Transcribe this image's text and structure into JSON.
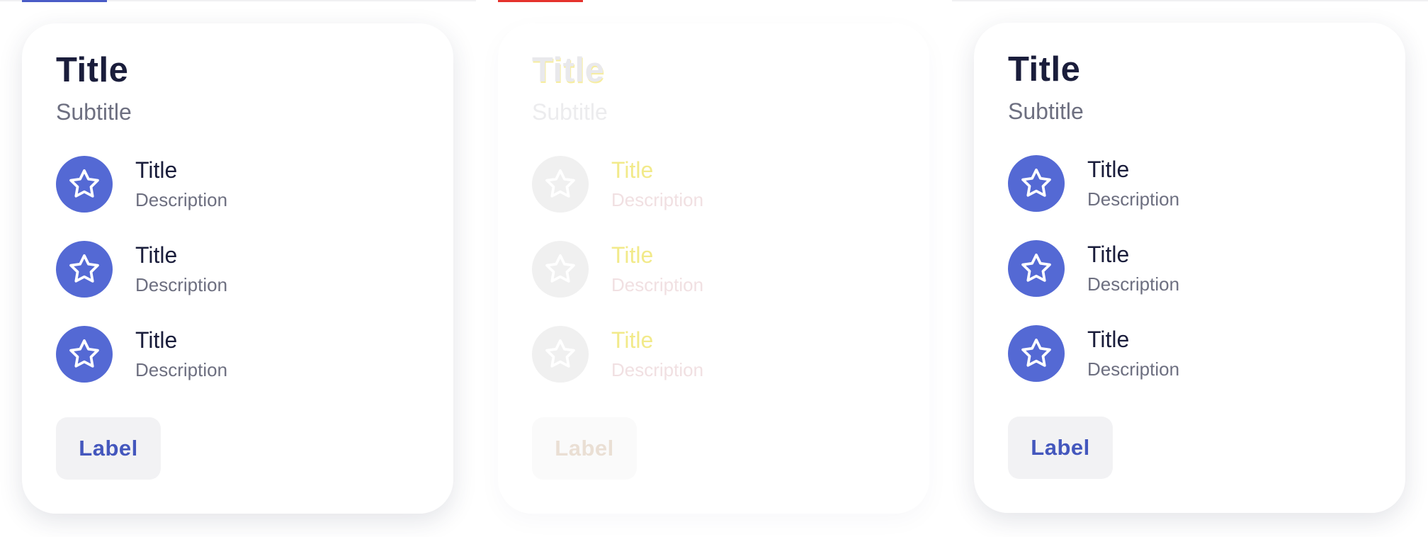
{
  "colors": {
    "accent": "#5469d4",
    "title_text": "#1a1d3b",
    "secondary_text": "#6d6f80",
    "button_bg": "#f2f2f4",
    "button_text": "#4457bd"
  },
  "cards": [
    {
      "title": "Title",
      "subtitle": "Subtitle",
      "items": [
        {
          "icon": "star-icon",
          "title": "Title",
          "description": "Description"
        },
        {
          "icon": "star-icon",
          "title": "Title",
          "description": "Description"
        },
        {
          "icon": "star-icon",
          "title": "Title",
          "description": "Description"
        }
      ],
      "button_label": "Label"
    },
    {
      "title": "Title",
      "subtitle": "Subtitle",
      "items": [
        {
          "icon": "star-icon",
          "title": "Title",
          "description": "Description"
        },
        {
          "icon": "star-icon",
          "title": "Title",
          "description": "Description"
        },
        {
          "icon": "star-icon",
          "title": "Title",
          "description": "Description"
        }
      ],
      "button_label": "Label"
    },
    {
      "title": "Title",
      "subtitle": "Subtitle",
      "items": [
        {
          "icon": "star-icon",
          "title": "Title",
          "description": "Description"
        },
        {
          "icon": "star-icon",
          "title": "Title",
          "description": "Description"
        },
        {
          "icon": "star-icon",
          "title": "Title",
          "description": "Description"
        }
      ],
      "button_label": "Label"
    }
  ]
}
